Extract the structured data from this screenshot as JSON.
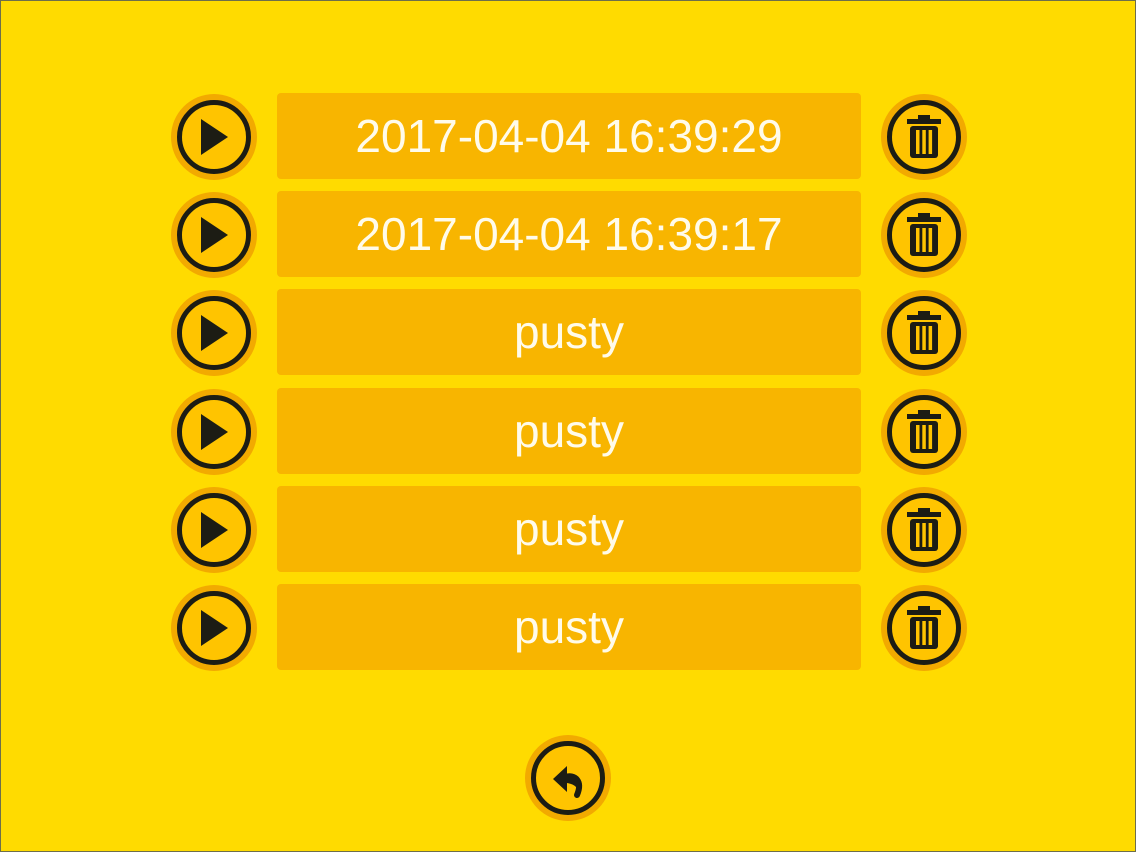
{
  "slots": [
    {
      "label": "2017-04-04 16:39:29"
    },
    {
      "label": "2017-04-04 16:39:17"
    },
    {
      "label": "pusty"
    },
    {
      "label": "pusty"
    },
    {
      "label": "pusty"
    },
    {
      "label": "pusty"
    }
  ],
  "icons": {
    "play": "play-icon",
    "delete": "trash-icon",
    "back": "undo-arrow-icon"
  },
  "colors": {
    "background": "#FFDB00",
    "slot": "#F8B500",
    "button_outer": "#F2AA00",
    "button_inner": "#FFC400",
    "icon": "#1c1c14",
    "text": "#FFFBEA"
  }
}
